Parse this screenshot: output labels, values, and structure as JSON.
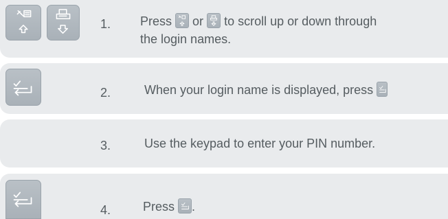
{
  "steps": [
    {
      "number": "1.",
      "line1_a": "Press",
      "line1_b": "or",
      "line1_c": "to scroll up or down through",
      "line2": "the login names.",
      "keys": [
        "tools-up-icon",
        "printer-down-icon"
      ]
    },
    {
      "number": "2.",
      "text": "When your login name is displayed, press",
      "keys": [
        "enter-icon"
      ]
    },
    {
      "number": "3.",
      "text": "Use the keypad to enter your PIN number."
    },
    {
      "number": "4.",
      "text": "Press",
      "suffix": ".",
      "keys": [
        "enter-icon"
      ]
    }
  ],
  "colors": {
    "band": "#e9ebed",
    "key": "#aab2b9",
    "text": "#555c60",
    "glyph": "#ffffff"
  }
}
